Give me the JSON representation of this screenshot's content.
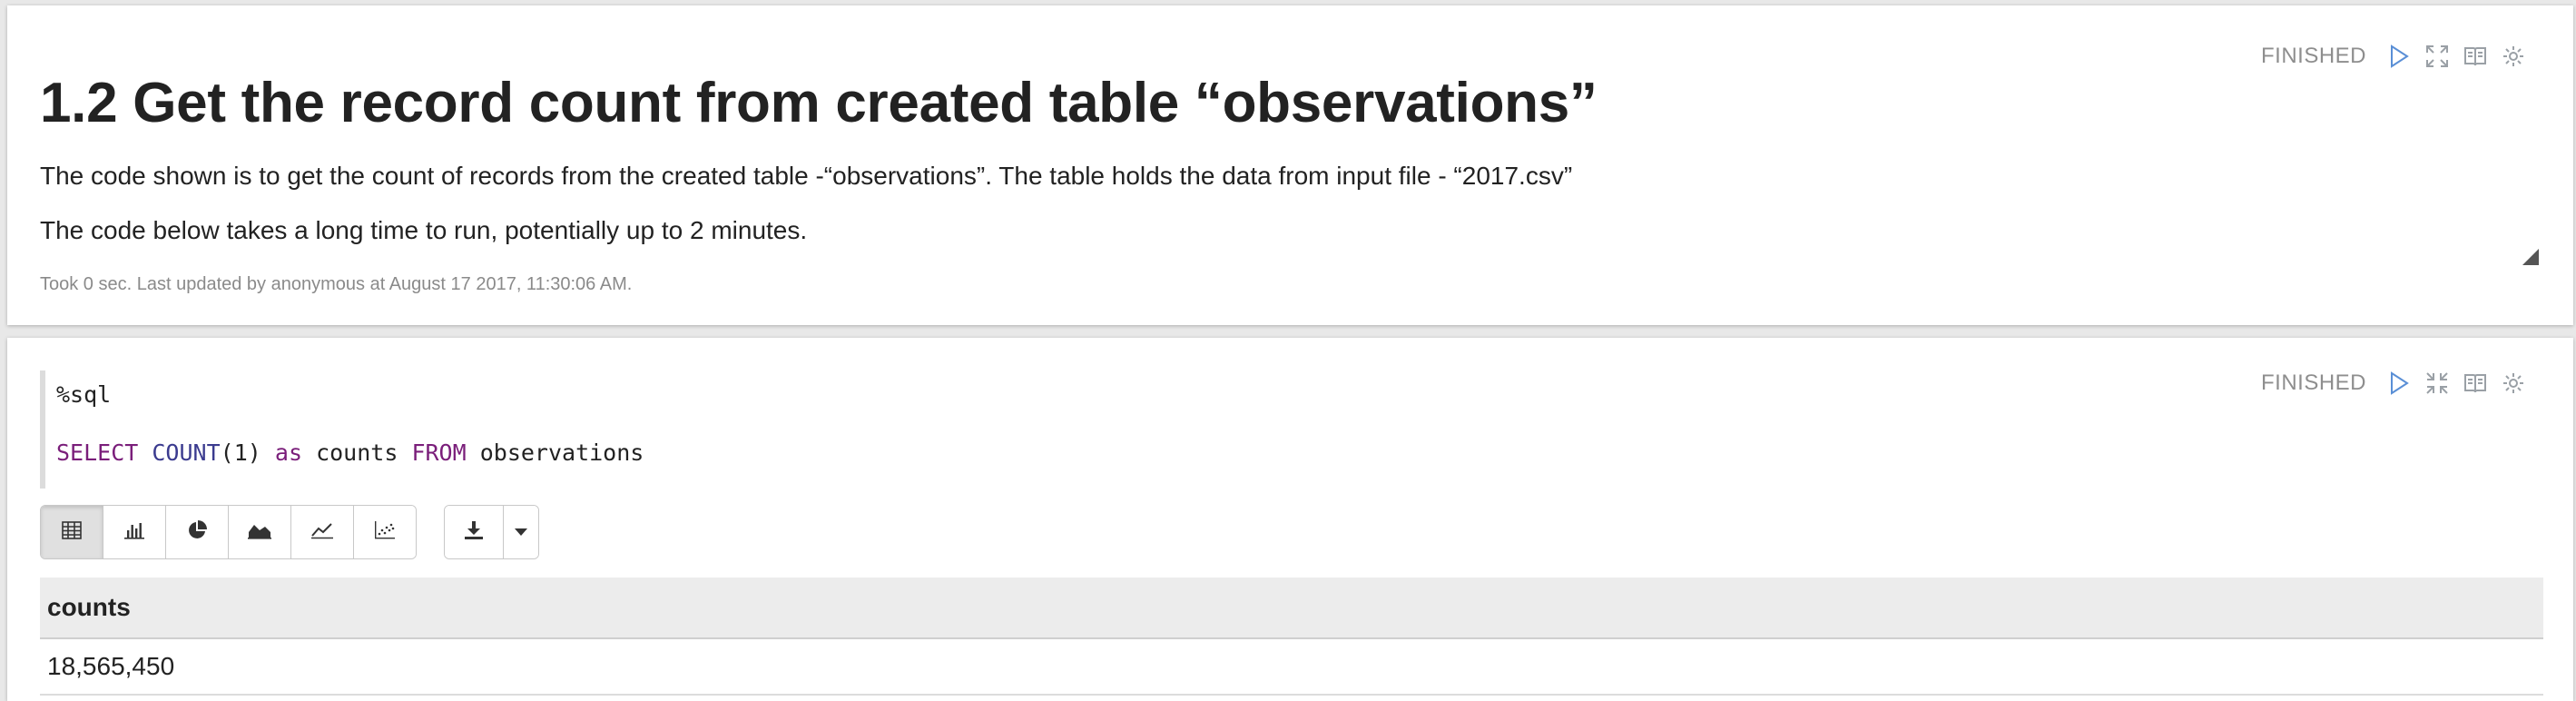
{
  "paragraph1": {
    "status": "FINISHED",
    "title": "1.2 Get the record count from created table “observations”",
    "text1": "The code shown is to get the count of records from the created table -“observations”. The table holds the data from input file - “2017.csv”",
    "text2": "The code below takes a long time to run, potentially up to 2 minutes.",
    "footer": "Took 0 sec. Last updated by anonymous at August 17 2017, 11:30:06 AM.",
    "icons": [
      "run-icon",
      "expand-icon",
      "book-icon",
      "gear-icon"
    ]
  },
  "paragraph2": {
    "status": "FINISHED",
    "code": {
      "interpreter": "%sql",
      "kw_select": "SELECT",
      "fn_count": "COUNT",
      "paren_open": "(",
      "num_arg": "1",
      "paren_close": ")",
      "kw_as": "as",
      "alias": "counts",
      "kw_from": "FROM",
      "table": "observations"
    },
    "icons": [
      "run-icon",
      "collapse-icon",
      "book-icon",
      "gear-icon"
    ],
    "viz_buttons": [
      "table-icon",
      "bar-chart-icon",
      "pie-chart-icon",
      "area-chart-icon",
      "line-chart-icon",
      "scatter-chart-icon"
    ],
    "active_viz": "table-icon",
    "download_buttons": [
      "download-icon",
      "caret-down-icon"
    ],
    "table": {
      "columns": [
        "counts"
      ],
      "rows": [
        [
          "18,565,450"
        ]
      ]
    }
  },
  "colors": {
    "keyword": "#7a1e7a",
    "function": "#3b3b8f",
    "status_text": "#8e8e8e",
    "icon": "#9aa0a6",
    "table_header_bg": "#ececec"
  }
}
